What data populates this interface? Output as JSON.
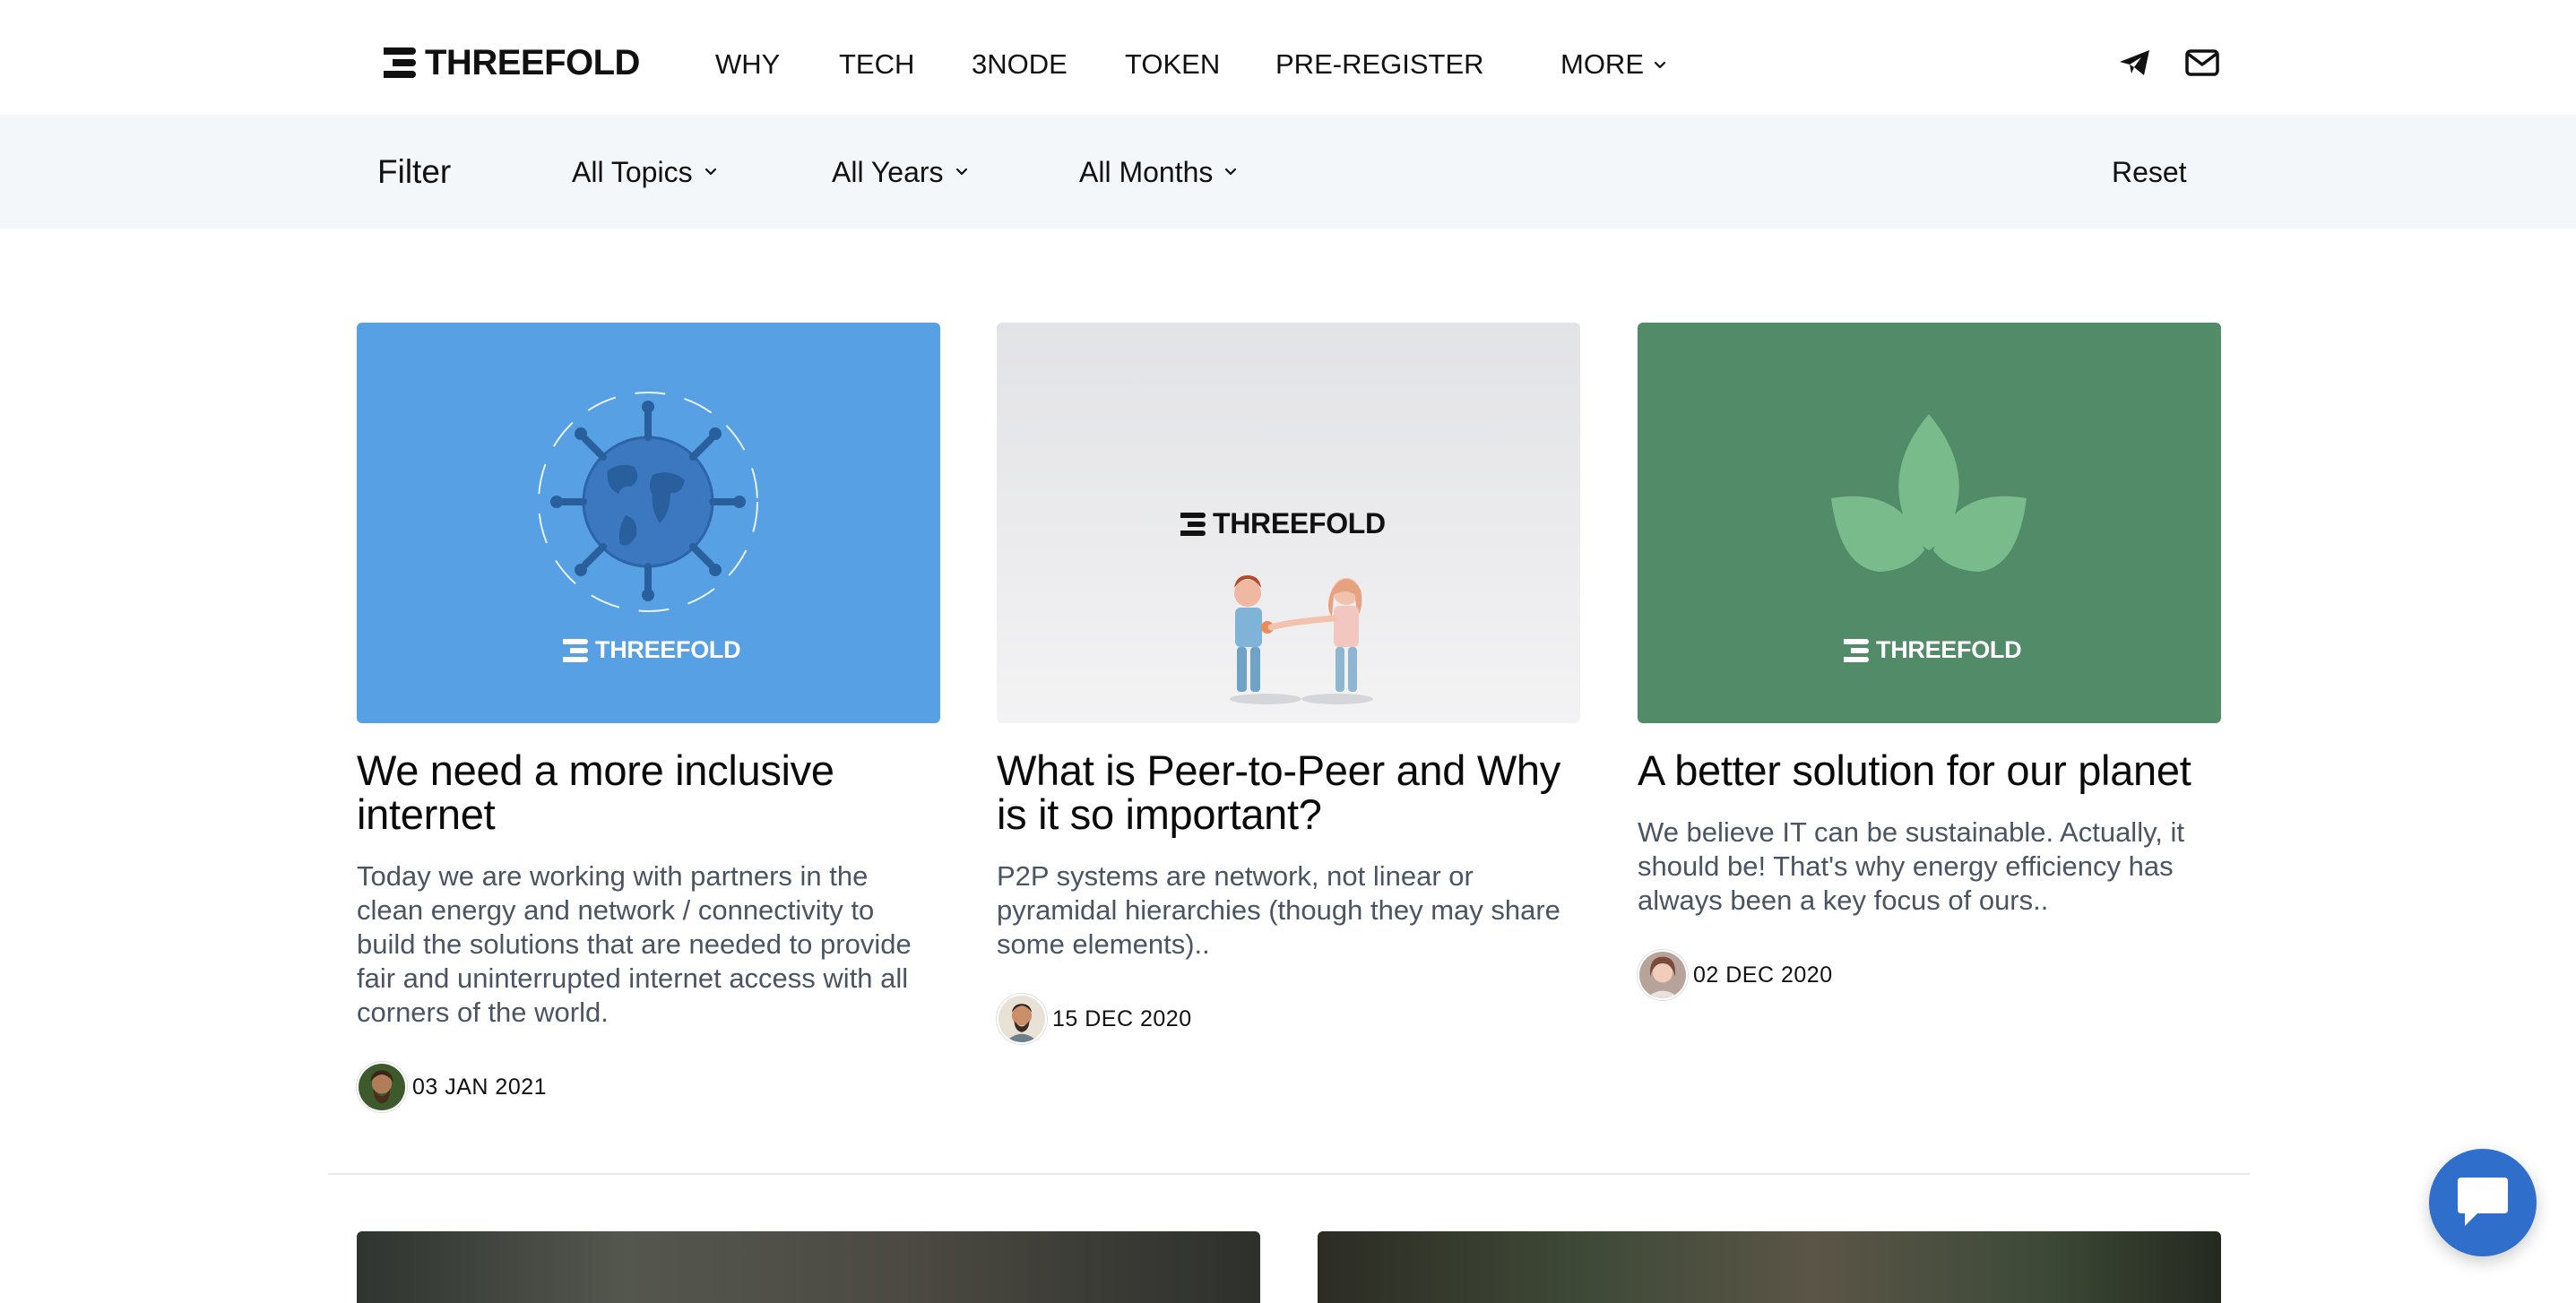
{
  "brand": {
    "name": "THREEFOLD"
  },
  "nav": {
    "items": [
      "WHY",
      "TECH",
      "3NODE",
      "TOKEN",
      "PRE-REGISTER"
    ],
    "more_label": "MORE"
  },
  "header_icons": [
    "telegram-icon",
    "mail-icon"
  ],
  "filter": {
    "label": "Filter",
    "topics": "All Topics",
    "years": "All Years",
    "months": "All Months",
    "reset": "Reset"
  },
  "posts": [
    {
      "title": "We need a more inclusive internet",
      "excerpt": "Today we are working with partners in the clean energy and network / connectivity to build the solutions that are needed to provide fair and uninterrupted internet access with all corners of the world.",
      "date": "03 JAN 2021",
      "image_brand": "THREEFOLD"
    },
    {
      "title": "What is Peer-to-Peer and Why is it so important?",
      "excerpt": "P2P systems are network, not linear or pyramidal hierarchies (though they may share some elements)..",
      "date": "15 DEC 2020",
      "image_brand": "THREEFOLD"
    },
    {
      "title": "A better solution for our planet",
      "excerpt": "We believe IT can be sustainable. Actually, it should be! That's why energy efficiency has always been a key focus of ours..",
      "date": "02 DEC 2020",
      "image_brand": "THREEFOLD"
    }
  ],
  "colors": {
    "card1_bg": "#57a0e4",
    "card3_bg": "#528b68",
    "filter_bg": "#f4f7fa",
    "chat_button": "#2f6fcb"
  }
}
